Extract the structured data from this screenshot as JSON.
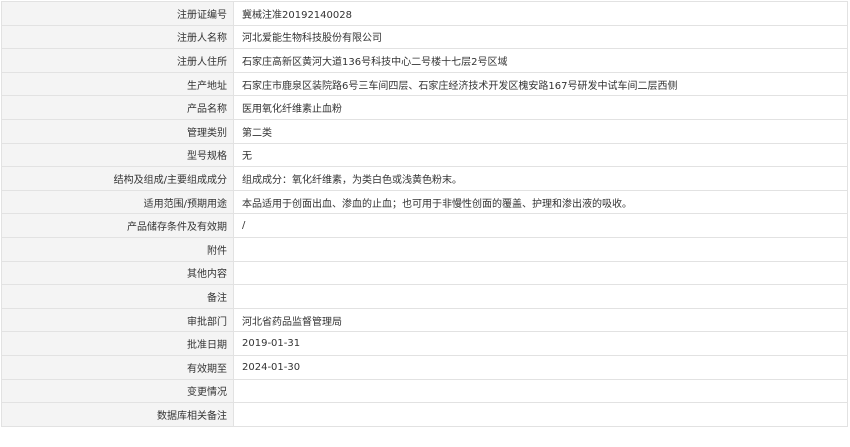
{
  "record": {
    "rows": [
      {
        "label": "注册证编号",
        "value": "冀械注准20192140028"
      },
      {
        "label": "注册人名称",
        "value": "河北爱能生物科技股份有限公司"
      },
      {
        "label": "注册人住所",
        "value": "石家庄高新区黄河大道136号科技中心二号楼十七层2号区域"
      },
      {
        "label": "生产地址",
        "value": "石家庄市鹿泉区装院路6号三车间四层、石家庄经济技术开发区槐安路167号研发中试车间二层西侧"
      },
      {
        "label": "产品名称",
        "value": "医用氧化纤维素止血粉"
      },
      {
        "label": "管理类别",
        "value": "第二类"
      },
      {
        "label": "型号规格",
        "value": "无"
      },
      {
        "label": "结构及组成/主要组成成分",
        "value": "组成成分：氧化纤维素，为类白色或浅黄色粉末。"
      },
      {
        "label": "适用范围/预期用途",
        "value": "本品适用于创面出血、渗血的止血；也可用于非慢性创面的覆盖、护理和渗出液的吸收。"
      },
      {
        "label": "产品储存条件及有效期",
        "value": "/"
      },
      {
        "label": "附件",
        "value": ""
      },
      {
        "label": "其他内容",
        "value": ""
      },
      {
        "label": "备注",
        "value": ""
      },
      {
        "label": "审批部门",
        "value": "河北省药品监督管理局"
      },
      {
        "label": "批准日期",
        "value": "2019-01-31"
      },
      {
        "label": "有效期至",
        "value": "2024-01-30"
      },
      {
        "label": "变更情况",
        "value": ""
      },
      {
        "label": "数据库相关备注",
        "value": ""
      }
    ]
  }
}
